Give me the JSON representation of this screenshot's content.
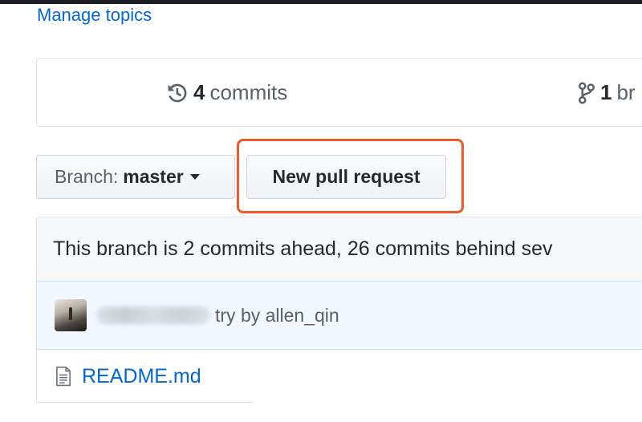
{
  "header": {
    "manage_topics": "Manage topics"
  },
  "summary": {
    "commits_count": "4",
    "commits_label": "commits",
    "branches_count": "1",
    "branches_label": "br"
  },
  "toolbar": {
    "branch_prefix": "Branch:",
    "branch_name": "master",
    "new_pull_request": "New pull request"
  },
  "branch_info": {
    "text": "This branch is 2 commits ahead, 26 commits behind sev"
  },
  "latest_commit": {
    "message": "try by allen_qin"
  },
  "files": [
    {
      "name": "README.md"
    }
  ],
  "colors": {
    "link": "#0366d6",
    "highlight": "#ee5a2a",
    "commit_bar": "#f1f8ff"
  }
}
